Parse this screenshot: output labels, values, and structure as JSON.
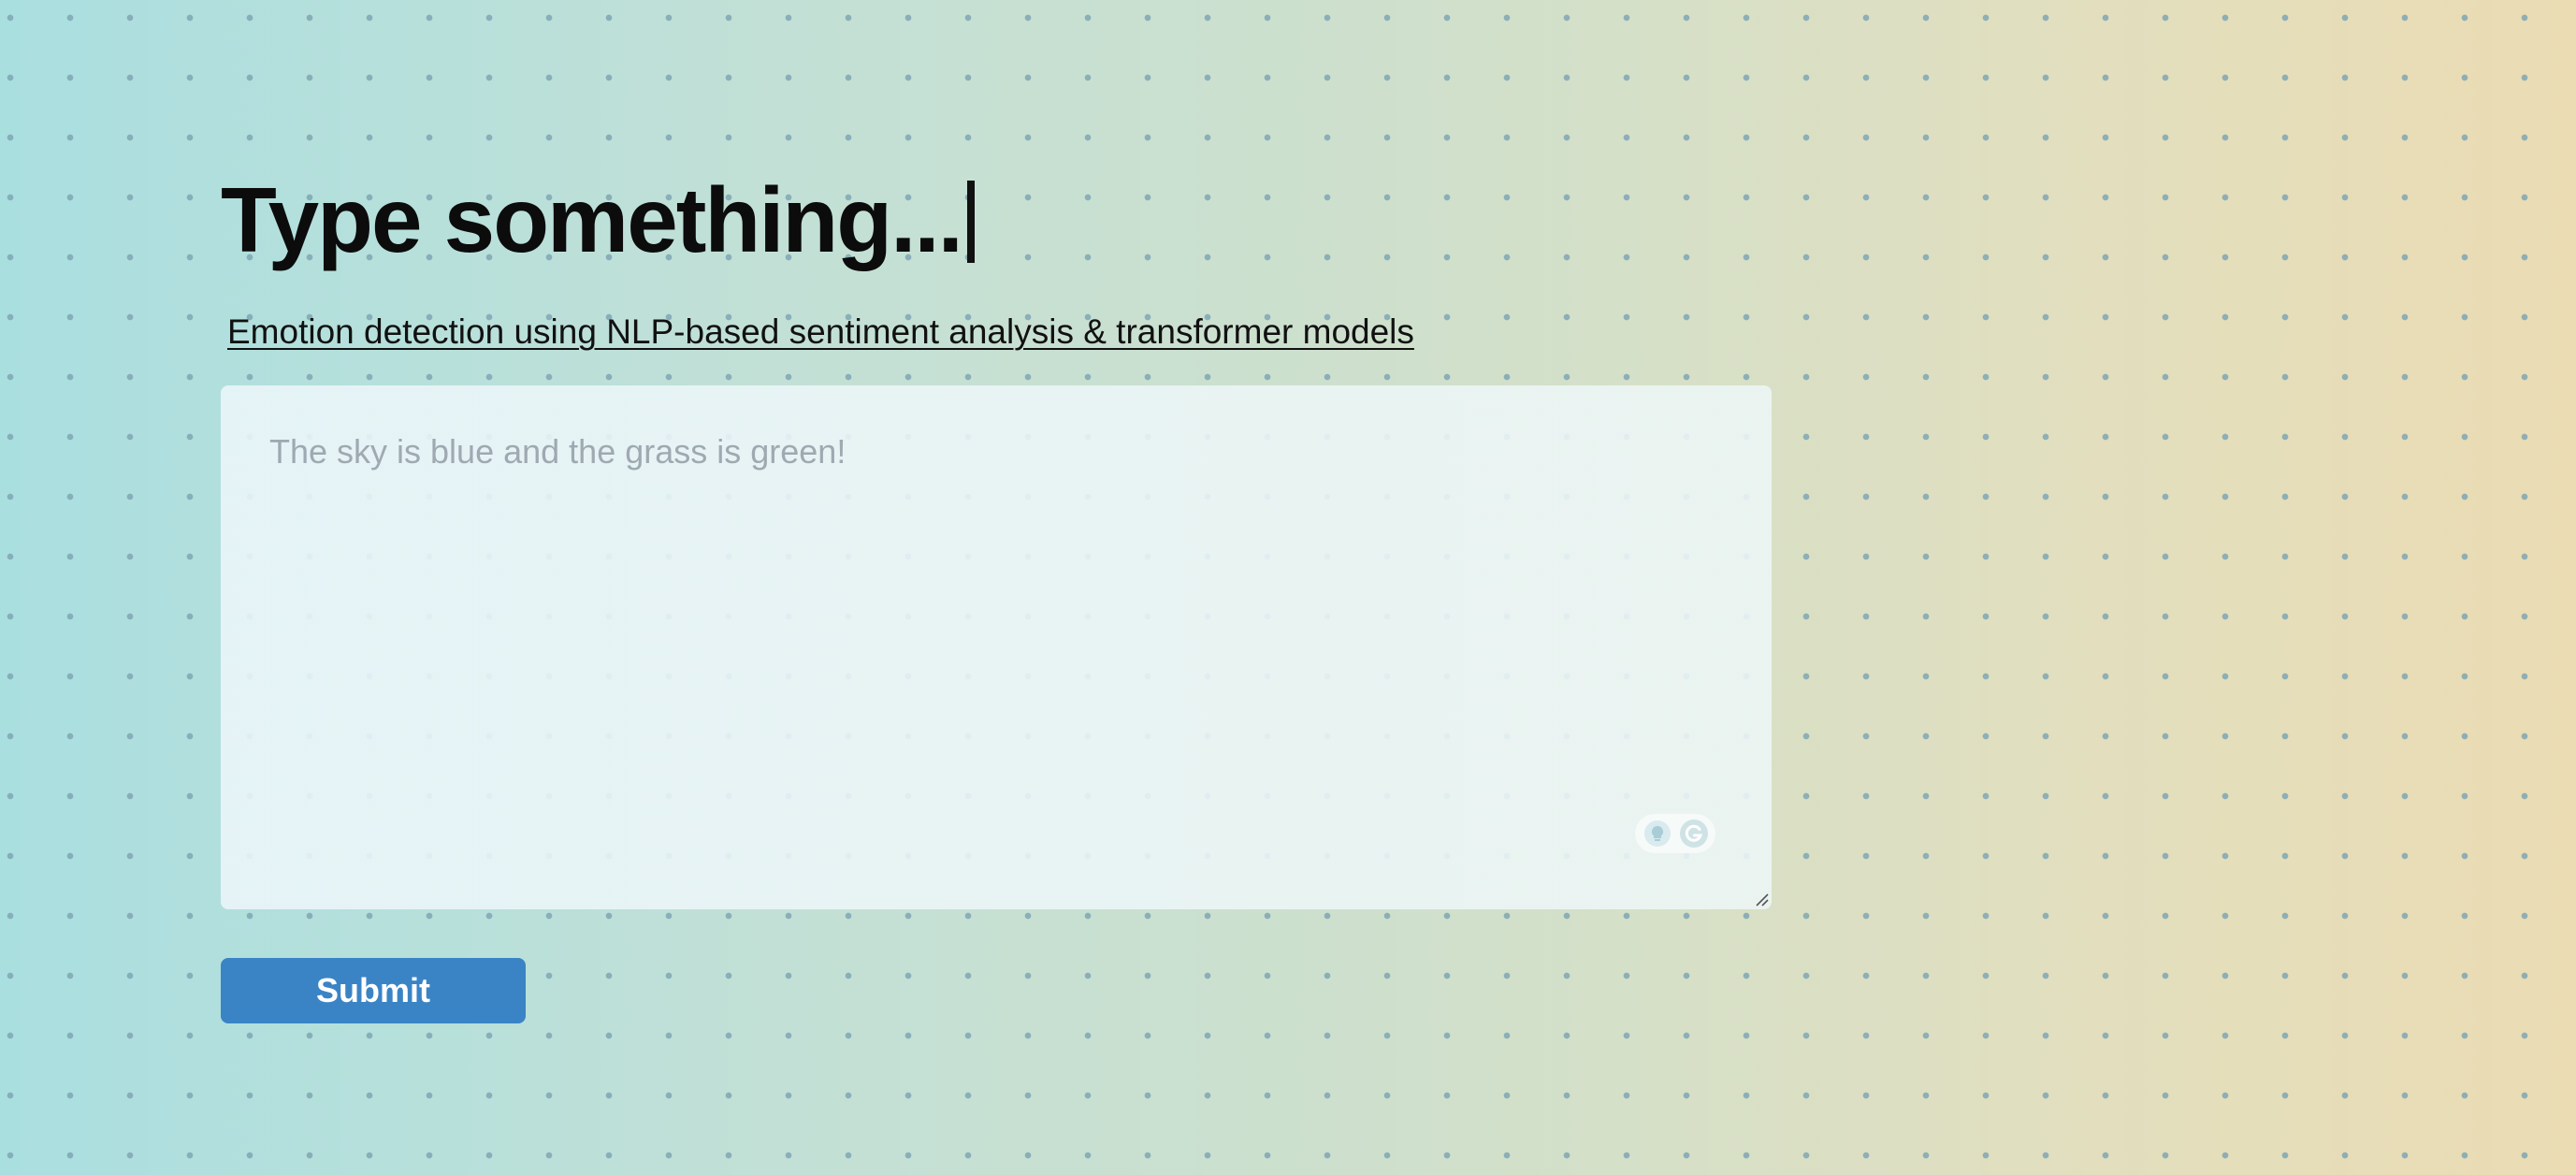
{
  "header": {
    "title": "Type something...",
    "subtitle": "Emotion detection using NLP-based sentiment analysis & transformer models"
  },
  "input": {
    "value": "",
    "placeholder": "The sky is blue and the grass is green!"
  },
  "extension_icons": [
    "lightbulb-icon",
    "grammarly-icon"
  ],
  "submit": {
    "label": "Submit"
  },
  "colors": {
    "button": "#3a84c6",
    "title": "#0c0c0c",
    "placeholder": "#9ea9b1"
  }
}
